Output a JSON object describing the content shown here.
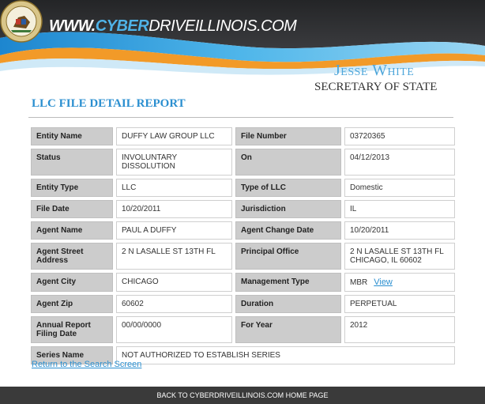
{
  "header": {
    "url_part1": "WWW.",
    "url_part2": "CYBER",
    "url_part3": "DRIVEILLINOIS.COM",
    "official_name": "Jesse White",
    "official_title": "SECRETARY OF STATE",
    "seal_icon": "illinois-state-seal-icon"
  },
  "report": {
    "title": "LLC FILE DETAIL REPORT",
    "rows": [
      {
        "l1": "Entity Name",
        "v1": "DUFFY LAW GROUP LLC",
        "l2": "File Number",
        "v2": "03720365"
      },
      {
        "l1": "Status",
        "v1": "INVOLUNTARY DISSOLUTION",
        "l2": "On",
        "v2": "04/12/2013"
      },
      {
        "l1": "Entity Type",
        "v1": "LLC",
        "l2": "Type of LLC",
        "v2": "Domestic"
      },
      {
        "l1": "File Date",
        "v1": "10/20/2011",
        "l2": "Jurisdiction",
        "v2": "IL"
      },
      {
        "l1": "Agent Name",
        "v1": "PAUL A DUFFY",
        "l2": "Agent Change Date",
        "v2": "10/20/2011"
      },
      {
        "l1": "Agent Street Address",
        "v1": "2 N LASALLE ST 13TH FL",
        "l2": "Principal Office",
        "v2": "2 N LASALLE ST 13TH FL CHICAGO, IL 60602"
      },
      {
        "l1": "Agent City",
        "v1": "CHICAGO",
        "l2": "Management Type",
        "v2": "MBR",
        "v2_link": "View"
      },
      {
        "l1": "Agent Zip",
        "v1": "60602",
        "l2": "Duration",
        "v2": "PERPETUAL"
      },
      {
        "l1": "Annual Report Filing Date",
        "v1": "00/00/0000",
        "l2": "For Year",
        "v2": "2012"
      }
    ],
    "series": {
      "label": "Series Name",
      "value": "NOT AUTHORIZED TO ESTABLISH SERIES"
    }
  },
  "links": {
    "return": "Return to the Search Screen",
    "footer": "BACK TO CYBERDRIVEILLINOIS.COM HOME PAGE"
  },
  "colors": {
    "accent_blue": "#2b8fd0",
    "wave_orange": "#f29a28",
    "header_dark": "#2f3033",
    "label_gray": "#cccccc",
    "footer_dark": "#3a3a3a"
  }
}
